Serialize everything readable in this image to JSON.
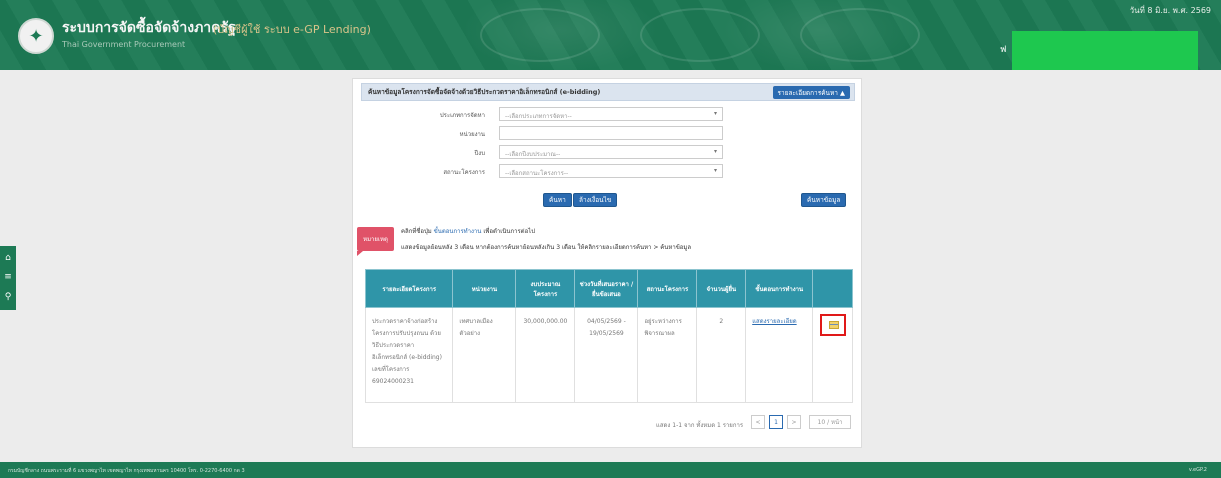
{
  "header": {
    "title": "ระบบการจัดซื้อจัดจ้างภาครัฐ",
    "subtitle": "(บัญชีผู้ใช้ ระบบ e-GP Lending)",
    "subtitle_en": "Thai Government Procurement",
    "date": "วันที่ 8 มิ.ย. พ.ศ. 2569",
    "user_prefix": "ฟ"
  },
  "side_tools": [
    "home-icon",
    "menu-icon",
    "search-icon"
  ],
  "panel": {
    "title": "ค้นหาข้อมูลโครงการจัดซื้อจัดจ้างด้วยวิธีประกวดราคาอิเล็กทรอนิกส์ (e-bidding)",
    "toggle_label": "รายละเอียดการค้นหา ▲",
    "form": {
      "method_label": "ประเภทการจัดหา",
      "method_placeholder": "--เลือกประเภทการจัดหา--",
      "agency_label": "หน่วยงาน",
      "agency_value": "",
      "year_label": "ปีงบ",
      "year_placeholder": "--เลือกปีงบประมาณ--",
      "status_label": "สถานะโครงการ",
      "status_placeholder": "--เลือกสถานะโครงการ--"
    },
    "buttons": {
      "search": "ค้นหา",
      "clear": "ล้างเงื่อนไข",
      "export": "ค้นหาข้อมูล"
    },
    "notice": {
      "badge": "หมายเหตุ",
      "line1_prefix": "คลิกที่ชื่อปุ่ม",
      "line1_link": "ขั้นตอนการทำงาน",
      "line1_suffix": "เพื่อดำเนินการต่อไป",
      "line2": "แสดงข้อมูลย้อนหลัง 3 เดือน หากต้องการค้นหาย้อนหลังเกิน 3 เดือน ให้คลิกรายละเอียดการค้นหา > ค้นหาข้อมูล"
    },
    "table": {
      "headers": [
        "รายละเอียดโครงการ",
        "หน่วยงาน",
        "งบประมาณโครงการ",
        "ช่วงวันที่เสนอราคา / ยื่นข้อเสนอ",
        "สถานะโครงการ",
        "จำนวนผู้ยื่น",
        "ขั้นตอนการทำงาน",
        ""
      ],
      "rows": [
        {
          "detail": "ประกวดราคาจ้างก่อสร้างโครงการปรับปรุงถนน ด้วยวิธีประกวดราคาอิเล็กทรอนิกส์ (e-bidding) เลขที่โครงการ 69024000231",
          "agency": "เทศบาลเมืองตัวอย่าง",
          "budget": "30,000,000.00",
          "dates": "04/05/2569 - 19/05/2569",
          "status": "อยู่ระหว่างการพิจารณาผล",
          "bidders": "2",
          "step": "แสดงรายละเอียด",
          "action_icon": "payment-icon"
        }
      ]
    },
    "pager": {
      "info": "แสดง 1-1 จาก ทั้งหมด 1 รายการ",
      "prev": "<",
      "page": "1",
      "next": ">",
      "size": "10 / หน้า"
    }
  },
  "footer": {
    "text": "กรมบัญชีกลาง ถนนพระรามที่ 6 แขวงพญาไท เขตพญาไท กรุงเทพมหานคร 10400 โทร. 0-2270-6400 กด 3",
    "version": "v.eGP.2"
  }
}
